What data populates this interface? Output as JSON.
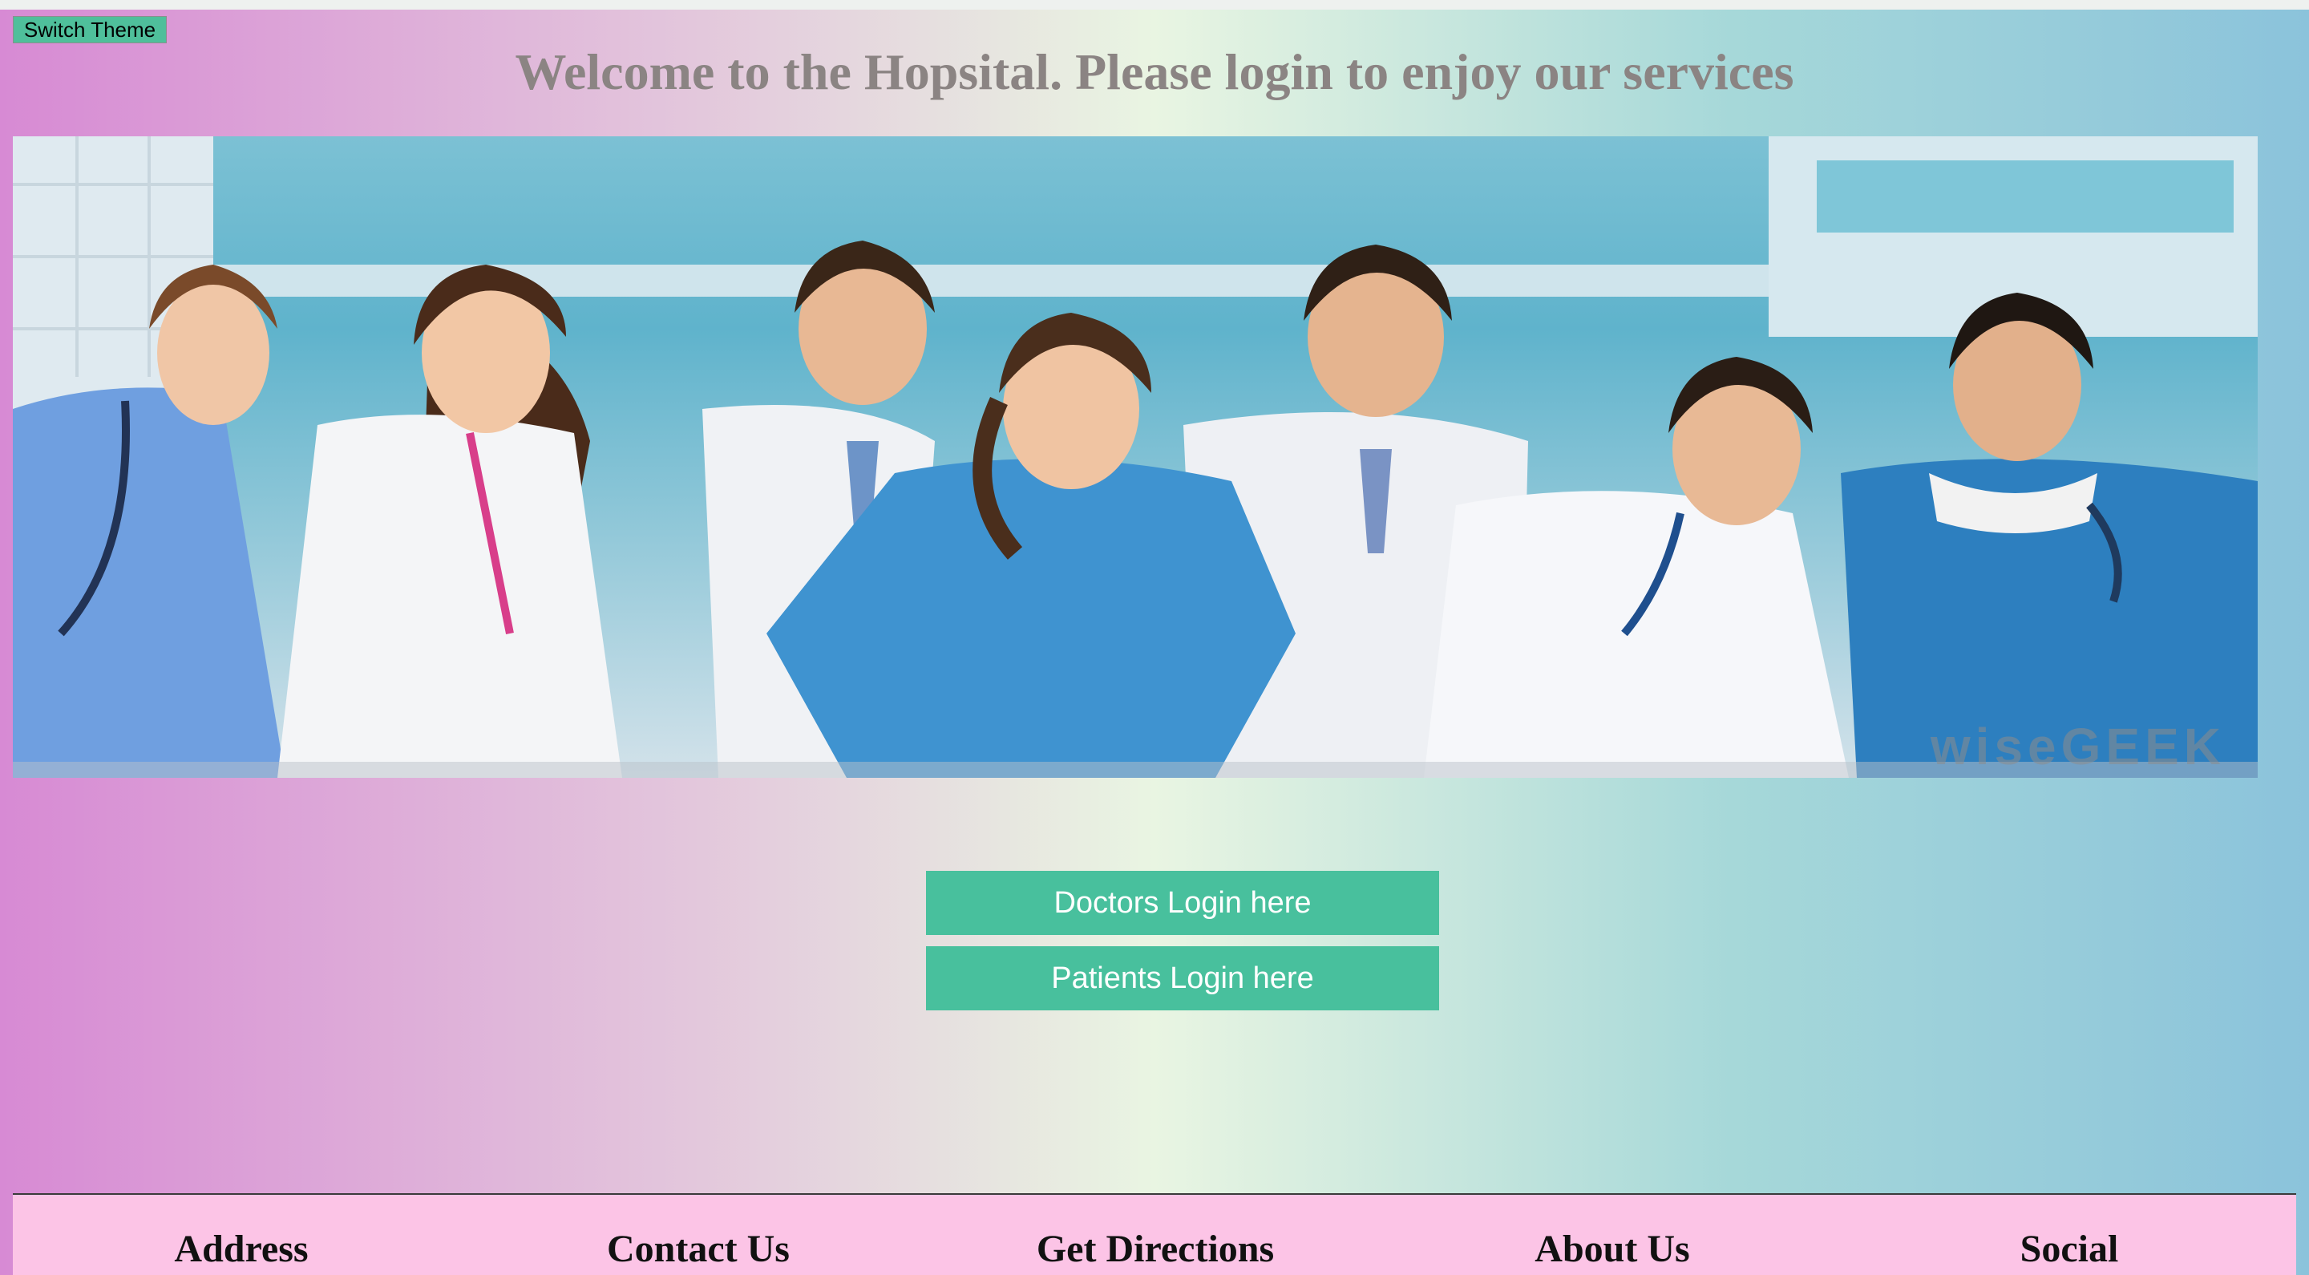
{
  "theme_toggle": {
    "label": "Switch Theme"
  },
  "header": {
    "title": "Welcome to the Hopsital. Please login to enjoy our services"
  },
  "hero": {
    "watermark": "wiseGEEK"
  },
  "login": {
    "doctors_label": "Doctors Login here",
    "patients_label": "Patients Login here"
  },
  "footer": {
    "columns": [
      {
        "label": "Address"
      },
      {
        "label": "Contact Us"
      },
      {
        "label": "Get Directions"
      },
      {
        "label": "About Us"
      },
      {
        "label": "Social"
      }
    ]
  },
  "colors": {
    "accent": "#48c09d",
    "title": "#8b8483",
    "footer_bg": "#fcc4e6"
  }
}
